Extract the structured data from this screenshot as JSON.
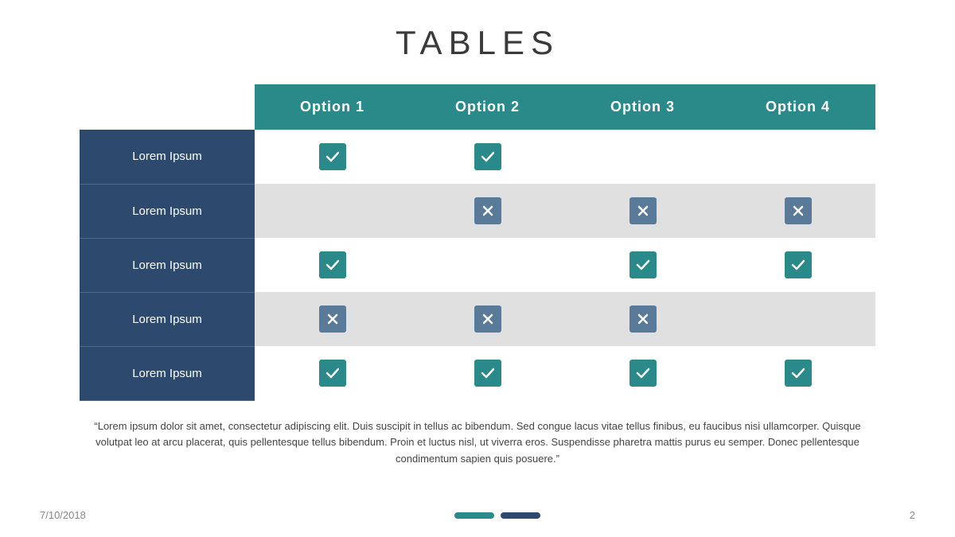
{
  "title": "TABLES",
  "header": {
    "col1": "",
    "col2": "Option 1",
    "col3": "Option 2",
    "col4": "Option 3",
    "col5": "Option 4"
  },
  "rows": [
    {
      "label": "Lorem Ipsum",
      "cells": [
        "check",
        "check",
        "empty",
        "empty"
      ]
    },
    {
      "label": "Lorem Ipsum",
      "cells": [
        "empty",
        "cross",
        "cross",
        "cross"
      ]
    },
    {
      "label": "Lorem Ipsum",
      "cells": [
        "check",
        "empty",
        "check",
        "check"
      ]
    },
    {
      "label": "Lorem Ipsum",
      "cells": [
        "cross",
        "cross",
        "cross",
        "empty"
      ]
    },
    {
      "label": "Lorem Ipsum",
      "cells": [
        "check",
        "check",
        "check",
        "check"
      ]
    }
  ],
  "quote": "“Lorem ipsum dolor sit amet, consectetur adipiscing elit. Duis suscipit in tellus ac bibendum. Sed congue lacus vitae tellus finibus, eu faucibus nisi ullamcorper. Quisque volutpat leo at arcu placerat,  quis pellentesque tellus bibendum. Proin et luctus nisl, ut viverra eros. Suspendisse pharetra mattis purus eu semper. Donec pellentesque condimentum sapien quis posuere.”",
  "footer": {
    "date": "7/10/2018",
    "page": "2"
  }
}
